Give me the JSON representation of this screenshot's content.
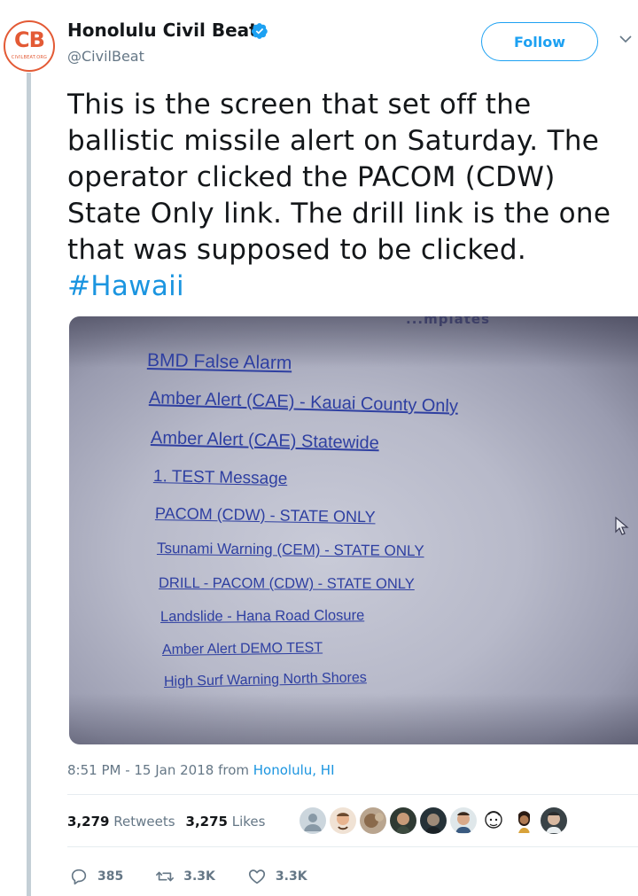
{
  "author": {
    "name": "Honolulu Civil Beat",
    "handle": "@CivilBeat",
    "avatar_text": "CB",
    "avatar_subtext": "CIVILBEAT.ORG",
    "verified": true
  },
  "follow_label": "Follow",
  "tweet": {
    "text": "This is the screen that set off the ballistic missile alert on Saturday. The operator clicked the PACOM (CDW) State Only link. The drill link is the one that was supposed to be clicked.",
    "hashtag": "#Hawaii"
  },
  "photo": {
    "header_fragment": "...mplates",
    "links": [
      "BMD False Alarm",
      "Amber Alert (CAE) - Kauai County Only",
      "Amber Alert (CAE) Statewide",
      "1. TEST Message",
      "PACOM (CDW) - STATE ONLY",
      "Tsunami Warning (CEM) - STATE ONLY",
      "DRILL - PACOM (CDW) - STATE ONLY",
      "Landslide - Hana Road Closure",
      "Amber Alert DEMO TEST",
      "High Surf Warning North Shores"
    ]
  },
  "meta": {
    "time": "8:51 PM - 15 Jan 2018 from ",
    "location": "Honolulu, HI"
  },
  "stats": {
    "retweets_count": "3,279",
    "retweets_label": "Retweets",
    "likes_count": "3,275",
    "likes_label": "Likes"
  },
  "actions": {
    "replies": "385",
    "retweets": "3.3K",
    "likes": "3.3K"
  },
  "colors": {
    "accent": "#1da1f2",
    "brand": "#e35a35",
    "link_in_photo": "#2e3fa1"
  }
}
